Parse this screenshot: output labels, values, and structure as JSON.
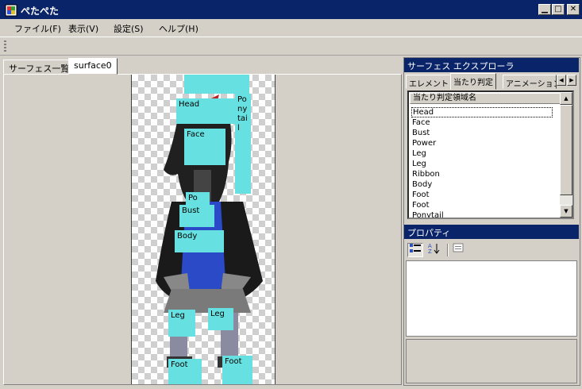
{
  "window": {
    "title": "ぺたぺた"
  },
  "menu": [
    "ファイル(F)",
    "表示(V)",
    "設定(S)",
    "ヘルプ(H)"
  ],
  "left_tabs": [
    "サーフェス一覧",
    "surface0"
  ],
  "canvas_regions": [
    "Head",
    "Pony tail",
    "Face",
    "Po",
    "Bust",
    "Body",
    "Leg",
    "Leg",
    "Foot",
    "Foot"
  ],
  "explorer": {
    "title": "サーフェス エクスプローラ",
    "tabs": [
      "エレメント",
      "当たり判定",
      "アニメーション"
    ],
    "column_header": "当たり判定領域名",
    "items": [
      "Head",
      "Face",
      "Bust",
      "Power",
      "Leg",
      "Leg",
      "Ribbon",
      "Body",
      "Foot",
      "Foot",
      "Ponytail"
    ]
  },
  "properties": {
    "title": "プロパティ"
  },
  "colors": {
    "titlebar": "#0a246a",
    "region": "#66e0e0",
    "chrome": "#d4d0c8"
  }
}
